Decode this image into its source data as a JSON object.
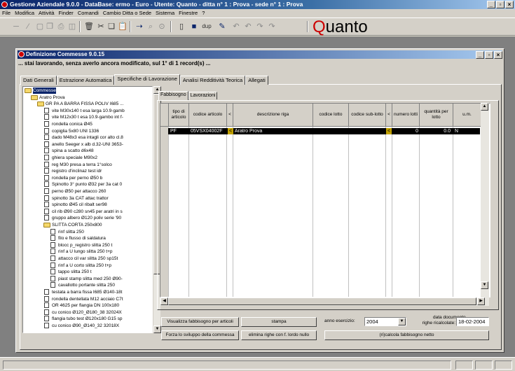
{
  "app": {
    "title": "Gestione Aziendale 9.0.0 - DataBase: ermo - Euro - Utente: Quanto - ditta n° 1 : Prova - sede n° 1 : Prova",
    "brand_q": "Q",
    "brand_rest": "uanto"
  },
  "menu": [
    "File",
    "Modifica",
    "Attività",
    "Finder",
    "Comandi",
    "Cambio Ditta o Sede",
    "Sistema",
    "Finestre",
    "?"
  ],
  "toolbar_icons": [
    "minus-icon",
    "slash-icon",
    "window-icon",
    "copy-icon",
    "print-icon",
    "new-icon",
    "delete-icon",
    "cut-icon",
    "copy2-icon",
    "paste-icon",
    "link-icon",
    "search-icon",
    "find-icon",
    "new-doc-icon",
    "save-icon",
    "dup-icon",
    "edit-icon",
    "undo-icon",
    "redo-icon"
  ],
  "child": {
    "title": "Definizione Commesse 9.0.15",
    "status": "... stai lavorando, senza averlo ancora modificato, sul 1° di 1 record(s) ..."
  },
  "tabs": [
    "Dati Generali",
    "Estrazione Automatica",
    "Specifiche di Lavorazione",
    "Analisi Redditività Teorica",
    "Allegati"
  ],
  "subtabs": [
    "Fabbisogno",
    "Lavorazioni"
  ],
  "tree": [
    {
      "label": "Commesse",
      "level": 0,
      "type": "folder",
      "expanded": true,
      "selected": true
    },
    {
      "label": "Aratro Prova",
      "level": 1,
      "type": "folder",
      "expanded": true
    },
    {
      "label": "GR PA A BARRA FISSA POLIV I685 ...",
      "level": 2,
      "type": "folder",
      "expanded": true
    },
    {
      "label": "vite M30x140 t esa larga 10.9-gamb",
      "level": 3,
      "type": "doc"
    },
    {
      "label": "vite M12x30 t esa 10.9-gambo int f-",
      "level": 3,
      "type": "doc"
    },
    {
      "label": "rondella conica Ø45",
      "level": 3,
      "type": "doc"
    },
    {
      "label": "copiglia 5x80 UNI 1336",
      "level": 3,
      "type": "doc"
    },
    {
      "label": "dado M48x3 esa intagli cor alto cl.8",
      "level": 3,
      "type": "doc"
    },
    {
      "label": "anello Seeger x alb d.32-UNI 3653-",
      "level": 3,
      "type": "doc"
    },
    {
      "label": "spina a scatto d6x48",
      "level": 3,
      "type": "doc"
    },
    {
      "label": "ghiera speciale M90x2",
      "level": 3,
      "type": "doc"
    },
    {
      "label": "reg M30 presa a terra 1°solco",
      "level": 3,
      "type": "doc"
    },
    {
      "label": "registro d'inclinaz test idr",
      "level": 3,
      "type": "doc"
    },
    {
      "label": "rondella per perno Ø50 b",
      "level": 3,
      "type": "doc"
    },
    {
      "label": "Spinotto 3° punto Ø32 per 3a cat 0",
      "level": 3,
      "type": "doc"
    },
    {
      "label": "perno Ø50 per attacco 260",
      "level": 3,
      "type": "doc"
    },
    {
      "label": "spinotto 3a CAT attac trattor",
      "level": 3,
      "type": "doc"
    },
    {
      "label": "spinotto Ø45 cil ribalt ser98",
      "level": 3,
      "type": "doc"
    },
    {
      "label": "cil rib Ø90 c280 sn45 per aratri in s",
      "level": 3,
      "type": "doc"
    },
    {
      "label": "gruppo albero Ø120 poliv serie '90",
      "level": 3,
      "type": "doc"
    },
    {
      "label": "SLITTA CORTA 250x800",
      "level": 3,
      "type": "folder",
      "expanded": true
    },
    {
      "label": "rinf slitta 250",
      "level": 4,
      "type": "doc"
    },
    {
      "label": "filo e flusso di saldatura",
      "level": 4,
      "type": "doc"
    },
    {
      "label": "blocc p_registro slitta 250 t",
      "level": 4,
      "type": "doc"
    },
    {
      "label": "rinf a U lungo slitta 250 t+p",
      "level": 4,
      "type": "doc"
    },
    {
      "label": "attacco cil var slitta 250 sp15t",
      "level": 4,
      "type": "doc"
    },
    {
      "label": "rinf a U corto slitta 250 t+p",
      "level": 4,
      "type": "doc"
    },
    {
      "label": "tappo slitta 250 t",
      "level": 4,
      "type": "doc"
    },
    {
      "label": "piast stamp slitta med 250 Ø90-",
      "level": 4,
      "type": "doc"
    },
    {
      "label": "cavallotto portante slitta 250",
      "level": 4,
      "type": "doc"
    },
    {
      "label": "testata a barra fissa I685 Ø140-18t",
      "level": 3,
      "type": "doc"
    },
    {
      "label": "rondella dentellata M12 acciaio C7t",
      "level": 3,
      "type": "doc"
    },
    {
      "label": "OR 4625 per flangia DN 100x180",
      "level": 3,
      "type": "doc"
    },
    {
      "label": "cu conico Ø120_Ø180_38 32024X",
      "level": 3,
      "type": "doc"
    },
    {
      "label": "flangia tubo test Ø120x180 G15 sp",
      "level": 3,
      "type": "doc"
    },
    {
      "label": "cu conico Ø90_Ø140_32 32018X",
      "level": 3,
      "type": "doc"
    }
  ],
  "grid": {
    "headers": [
      "tipo di articolo",
      "codice articolo",
      "<",
      "descrizione riga",
      "codice lotto",
      "codice sub-lotto",
      "<",
      "numero lotti",
      "quantità per lotto",
      "u.m."
    ],
    "rows": [
      {
        "tipo": "PF",
        "codice": "05VSX04002F",
        "flag": "<",
        "descrizione": "Aratro Prova",
        "lotto": "",
        "sublotto": "",
        "flag2": "<",
        "numero": "0",
        "quantita": "0.0",
        "um": "N"
      }
    ]
  },
  "controls": {
    "btn_visualizza": "Visualizza fabbisogno per articoli",
    "btn_stampa": "stampa",
    "lbl_anno": "anno esercizio:",
    "anno_value": "2004",
    "lbl_data_documento": "data documento",
    "lbl_righe_ricalcolate": "righe ricalcolate:",
    "data_value": "18-02-2004",
    "btn_forza": "Forza lo sviluppo della commessa",
    "btn_elimina": "elimina righe con f. lordo nullo",
    "btn_ricalcola": "(ri)calcola fabbisogno netto"
  }
}
